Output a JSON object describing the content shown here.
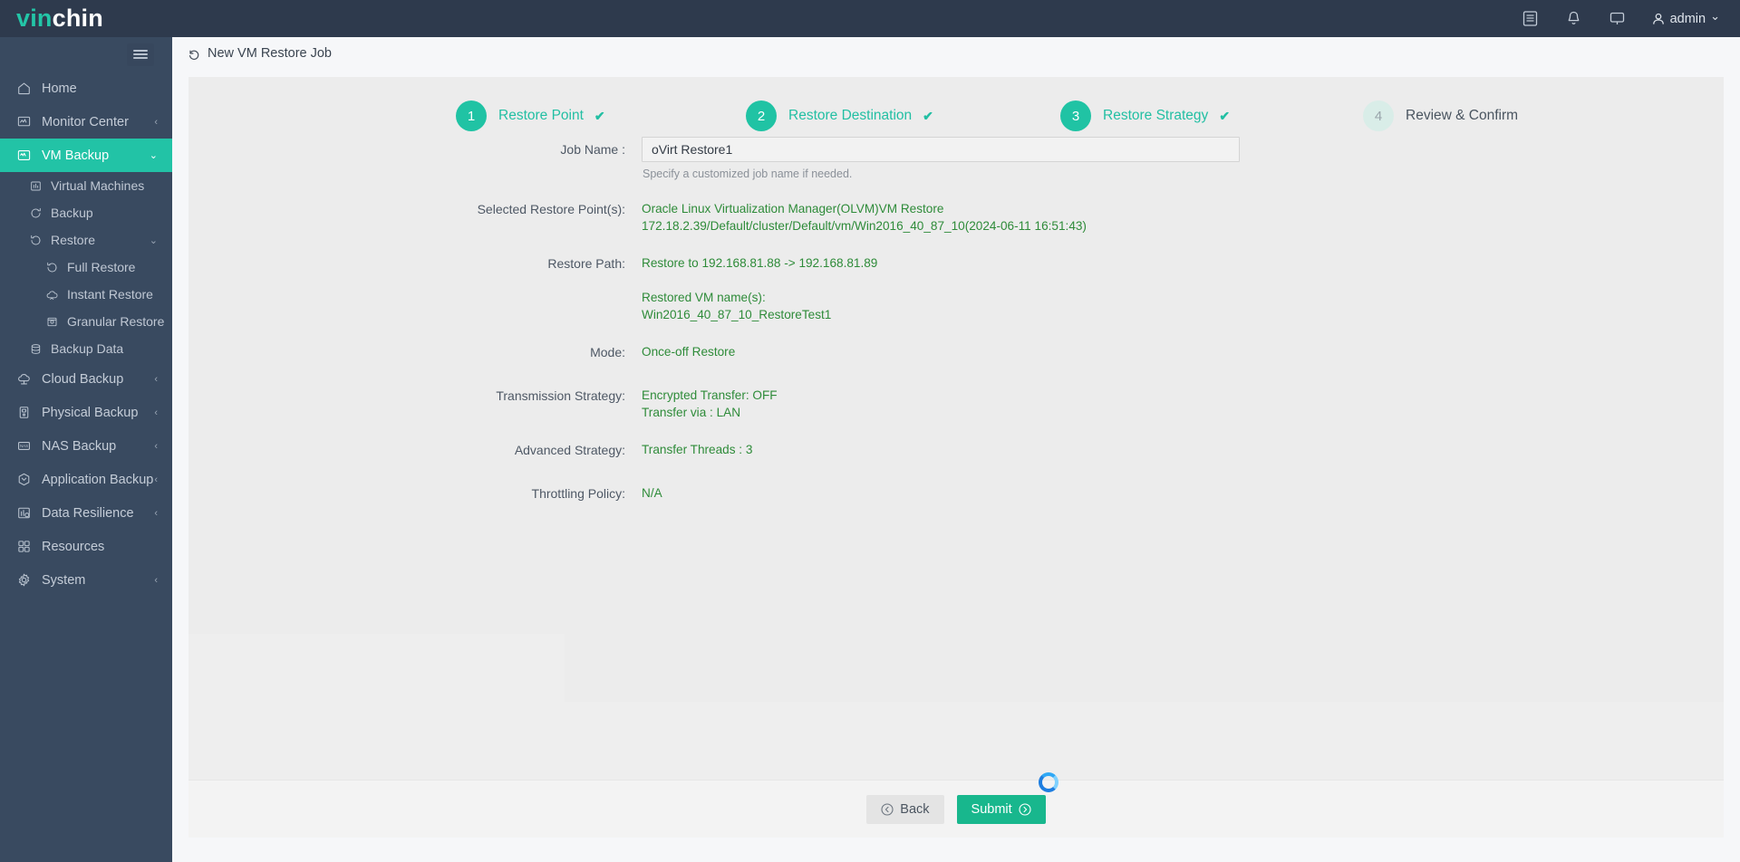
{
  "brand": {
    "part1": "vin",
    "part2": "chin"
  },
  "topbar": {
    "icons": [
      "list-icon",
      "bell-icon",
      "monitor-icon"
    ],
    "user": "admin",
    "user_chevron": "⌄"
  },
  "sidebar": {
    "collapse_label": "collapse-menu",
    "items": [
      {
        "label": "Home",
        "icon": "home-icon",
        "level": 0,
        "chevron": "",
        "active": false
      },
      {
        "label": "Monitor Center",
        "icon": "monitor-center-icon",
        "level": 0,
        "chevron": "‹",
        "active": false
      },
      {
        "label": "VM Backup",
        "icon": "vm-icon",
        "level": 0,
        "chevron": "⌄",
        "active": true
      },
      {
        "label": "Virtual Machines",
        "icon": "virtual-machines-icon",
        "level": 1,
        "chevron": "",
        "active": false
      },
      {
        "label": "Backup",
        "icon": "backup-icon",
        "level": 1,
        "chevron": "",
        "active": false
      },
      {
        "label": "Restore",
        "icon": "restore-icon",
        "level": 1,
        "chevron": "⌄",
        "active": false
      },
      {
        "label": "Full Restore",
        "icon": "full-restore-icon",
        "level": 2,
        "chevron": "",
        "active": false
      },
      {
        "label": "Instant Restore",
        "icon": "instant-restore-icon",
        "level": 2,
        "chevron": "",
        "active": false
      },
      {
        "label": "Granular Restore",
        "icon": "granular-restore-icon",
        "level": 2,
        "chevron": "",
        "active": false
      },
      {
        "label": "Backup Data",
        "icon": "backup-data-icon",
        "level": 1,
        "chevron": "",
        "active": false
      },
      {
        "label": "Cloud Backup",
        "icon": "cloud-backup-icon",
        "level": 0,
        "chevron": "‹",
        "active": false
      },
      {
        "label": "Physical Backup",
        "icon": "physical-backup-icon",
        "level": 0,
        "chevron": "‹",
        "active": false
      },
      {
        "label": "NAS Backup",
        "icon": "nas-backup-icon",
        "level": 0,
        "chevron": "‹",
        "active": false
      },
      {
        "label": "Application Backup",
        "icon": "application-backup-icon",
        "level": 0,
        "chevron": "‹",
        "active": false
      },
      {
        "label": "Data Resilience",
        "icon": "data-resilience-icon",
        "level": 0,
        "chevron": "‹",
        "active": false
      },
      {
        "label": "Resources",
        "icon": "resources-icon",
        "level": 0,
        "chevron": "",
        "active": false
      },
      {
        "label": "System",
        "icon": "system-icon",
        "level": 0,
        "chevron": "‹",
        "active": false
      }
    ]
  },
  "breadcrumb": {
    "icon": "back-arrow-icon",
    "title": "New VM Restore Job"
  },
  "steps": [
    {
      "num": "1",
      "label": "Restore Point",
      "done": true,
      "tick": "✔"
    },
    {
      "num": "2",
      "label": "Restore Destination",
      "done": true,
      "tick": "✔"
    },
    {
      "num": "3",
      "label": "Restore Strategy",
      "done": true,
      "tick": "✔"
    },
    {
      "num": "4",
      "label": "Review & Confirm",
      "done": false,
      "tick": ""
    }
  ],
  "form": {
    "job_name_label": "Job Name :",
    "job_name_value": "oVirt Restore1",
    "job_name_placeholder": "Specify a customized job name",
    "job_name_hint": "Specify a customized job name if needed.",
    "rows": [
      {
        "label": "Selected Restore Point(s):",
        "lines": [
          "Oracle Linux Virtualization Manager(OLVM)VM Restore",
          "172.18.2.39/Default/cluster/Default/vm/Win2016_40_87_10(2024-06-11 16:51:43)"
        ]
      },
      {
        "label": "Restore Path:",
        "lines": [
          "Restore to 192.168.81.88 -> 192.168.81.89",
          "",
          "Restored VM name(s):",
          "Win2016_40_87_10_RestoreTest1"
        ]
      },
      {
        "label": "Mode:",
        "lines": [
          "Once-off Restore"
        ]
      },
      {
        "label": "Transmission Strategy:",
        "lines": [
          "Encrypted Transfer: OFF",
          "Transfer via : LAN"
        ]
      },
      {
        "label": "Advanced Strategy:",
        "lines": [
          "Transfer Threads : 3"
        ]
      },
      {
        "label": "Throttling Policy:",
        "lines": [
          "N/A"
        ]
      }
    ]
  },
  "footer": {
    "back_label": "Back",
    "back_icon": "circle-left-arrow-icon",
    "submit_label": "Submit",
    "submit_icon": "circle-right-arrow-icon"
  },
  "colors": {
    "brand_teal": "#22c3a6",
    "sidebar_bg": "#394a60",
    "topbar_bg": "#2e3a4d",
    "value_green": "#2e8b39",
    "submit_green": "#18b78d"
  }
}
